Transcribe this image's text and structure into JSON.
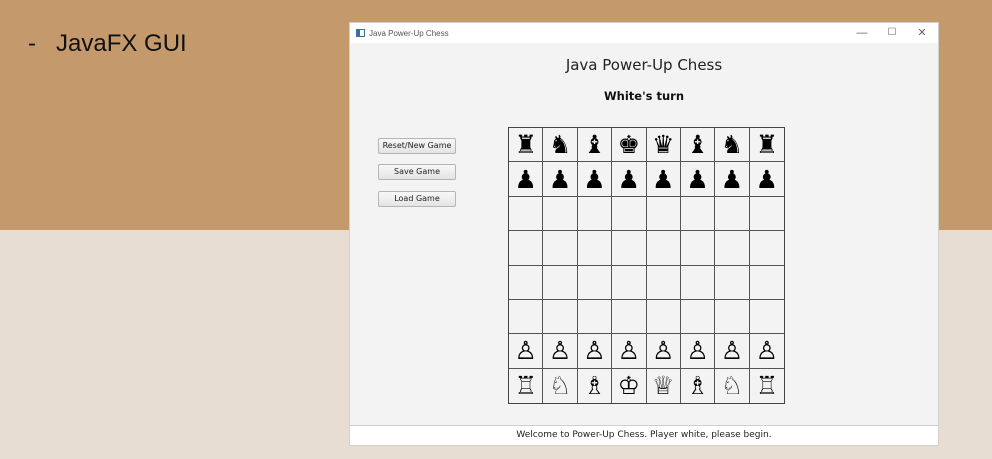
{
  "slide": {
    "bullet_dash": "-",
    "bullet_text": "JavaFX GUI",
    "colors": {
      "top_band": "#c49a6c",
      "bottom_band": "#e8ddd2"
    }
  },
  "window": {
    "title": "Java Power-Up Chess",
    "icon": "java-app-icon",
    "controls": {
      "minimize": "—",
      "maximize": "☐",
      "close": "✕"
    }
  },
  "game": {
    "title": "Java Power-Up Chess",
    "turn": "White's turn",
    "buttons": {
      "reset": "Reset/New Game",
      "save": "Save Game",
      "load": "Load Game"
    },
    "board": [
      [
        "♜",
        "♞",
        "♝",
        "♚",
        "♛",
        "♝",
        "♞",
        "♜"
      ],
      [
        "♟",
        "♟",
        "♟",
        "♟",
        "♟",
        "♟",
        "♟",
        "♟"
      ],
      [
        "",
        "",
        "",
        "",
        "",
        "",
        "",
        ""
      ],
      [
        "",
        "",
        "",
        "",
        "",
        "",
        "",
        ""
      ],
      [
        "",
        "",
        "",
        "",
        "",
        "",
        "",
        ""
      ],
      [
        "",
        "",
        "",
        "",
        "",
        "",
        "",
        ""
      ],
      [
        "♙",
        "♙",
        "♙",
        "♙",
        "♙",
        "♙",
        "♙",
        "♙"
      ],
      [
        "♖",
        "♘",
        "♗",
        "♔",
        "♕",
        "♗",
        "♘",
        "♖"
      ]
    ],
    "status": "Welcome to Power-Up Chess. Player white, please begin."
  }
}
